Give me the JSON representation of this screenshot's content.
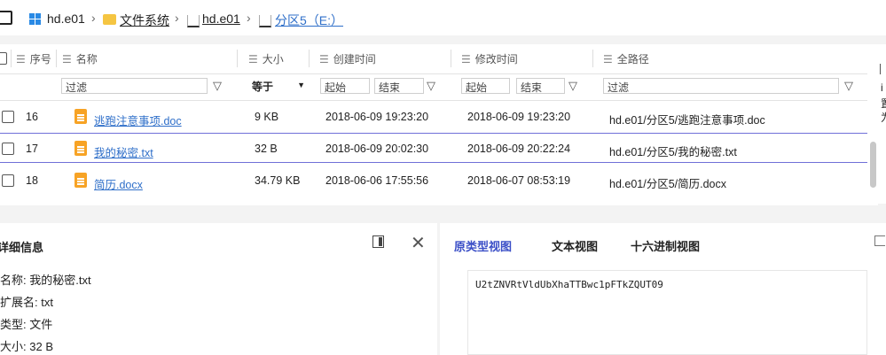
{
  "breadcrumb": {
    "items": [
      "hd.e01",
      "文件系统",
      "hd.e01",
      "分区5（E:）"
    ]
  },
  "table": {
    "headers": [
      "序号",
      "名称",
      "大小",
      "创建时间",
      "修改时间",
      "全路径"
    ],
    "filters": {
      "name_placeholder": "过滤",
      "size_op": "等于",
      "created_start": "起始",
      "created_end": "结束",
      "modified_start": "起始",
      "modified_end": "结束",
      "path_placeholder": "过滤"
    },
    "rows": [
      {
        "no": "16",
        "name": "逃跑注意事项.doc",
        "size": "9 KB",
        "created": "2018-06-09 19:23:20",
        "modified": "2018-06-09 19:23:20",
        "path": "hd.e01/分区5/逃跑注意事项.doc"
      },
      {
        "no": "17",
        "name": "我的秘密.txt",
        "size": "32 B",
        "created": "2018-06-09 20:02:30",
        "modified": "2018-06-09 20:22:24",
        "path": "hd.e01/分区5/我的秘密.txt"
      },
      {
        "no": "18",
        "name": "简历.docx",
        "size": "34.79 KB",
        "created": "2018-06-06 17:55:56",
        "modified": "2018-06-07 08:53:19",
        "path": "hd.e01/分区5/简历.docx"
      }
    ]
  },
  "right_edge_text": [
    "i",
    "置",
    "为"
  ],
  "detail": {
    "title": "详细信息",
    "fields": [
      {
        "label": "名称:",
        "value": "我的秘密.txt"
      },
      {
        "label": "扩展名:",
        "value": "txt"
      },
      {
        "label": "类型:",
        "value": "文件"
      },
      {
        "label": "大小:",
        "value": "32 B"
      }
    ]
  },
  "preview": {
    "tabs": [
      "原类型视图",
      "文本视图",
      "十六进制视图"
    ],
    "content": "U2tZNVRtVldUbXhaTTBwc1pFTkZQUT09"
  }
}
